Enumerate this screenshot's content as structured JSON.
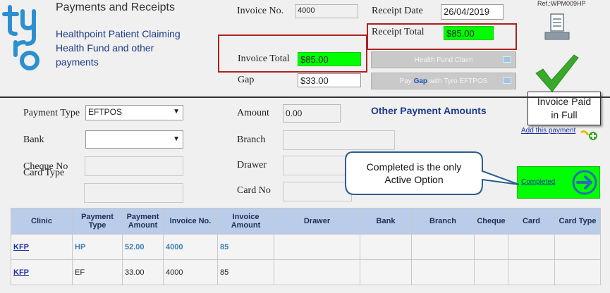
{
  "header": {
    "title": "Payments and Receipts",
    "subtitle_lines": [
      "Healthpoint Patient Claiming",
      "Health Fund and other",
      "payments"
    ],
    "logo_text": "tyro",
    "ref": "Ref.:WPM009HP"
  },
  "invoice": {
    "invoice_no_label": "Invoice No.",
    "invoice_no": "4000",
    "receipt_date_label": "Receipt Date",
    "receipt_date": "26/04/2019",
    "receipt_total_label": "Receipt Total",
    "receipt_total": "$85.00",
    "invoice_total_label": "Invoice Total",
    "invoice_total": "$85.00",
    "gap_label": "Gap",
    "gap": "$33.00"
  },
  "buttons": {
    "health_fund_claim": "Health Fund Claim",
    "pay_gap_prefix": "Pay ",
    "pay_gap_word": "Gap",
    "pay_gap_suffix": " with Tyro EFTPOS",
    "completed": "Completed",
    "add_payment": "Add this payment"
  },
  "status_note": {
    "line1": "Invoice Paid",
    "line2": "in Full"
  },
  "payment_form": {
    "payment_type_label": "Payment Type",
    "payment_type": "EFTPOS",
    "bank_label": "Bank",
    "bank": "",
    "cheque_no_label": "Cheque No",
    "card_type_label": "Card Type",
    "amount_label": "Amount",
    "amount": "0.00",
    "branch_label": "Branch",
    "drawer_label": "Drawer",
    "card_no_label": "Card No",
    "other_payments_title": "Other Payment Amounts"
  },
  "callout": {
    "line1": "Completed is the only",
    "line2": "Active Option"
  },
  "table": {
    "headers": [
      "Clinic",
      "Payment Type",
      "Payment Amount",
      "Invoice No.",
      "Invoice Amount",
      "Drawer",
      "Bank",
      "Branch",
      "Cheque",
      "Card",
      "Card Type"
    ],
    "rows": [
      [
        "KFP",
        "HP",
        "52.00",
        "4000",
        "85",
        "",
        "",
        "",
        "",
        "",
        ""
      ],
      [
        "KFP",
        "EF",
        "33.00",
        "4000",
        "85",
        "",
        "",
        "",
        "",
        "",
        ""
      ]
    ]
  },
  "colors": {
    "highlight": "#00ff00",
    "callout_border": "#b02020",
    "header_blue": "#1d3a8a",
    "table_header": "#b9cdea",
    "completed_bg": "#00ff00",
    "check_green": "#3aa82a"
  }
}
